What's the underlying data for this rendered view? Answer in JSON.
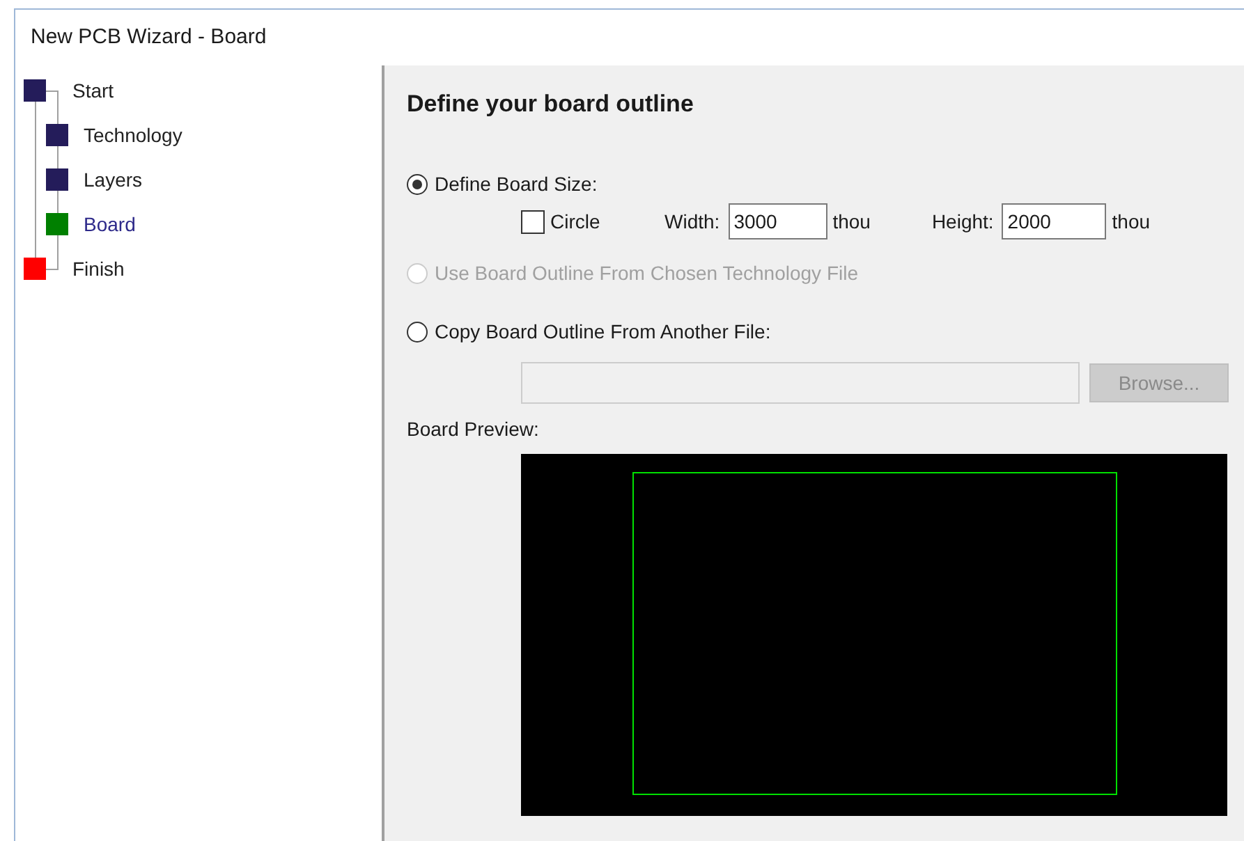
{
  "window": {
    "title": "New PCB Wizard - Board"
  },
  "steps": [
    {
      "label": "Start",
      "color": "#241c5a",
      "selected": false,
      "children": [
        {
          "label": "Technology",
          "color": "#241c5a",
          "selected": false
        },
        {
          "label": "Layers",
          "color": "#241c5a",
          "selected": false
        },
        {
          "label": "Board",
          "color": "#008000",
          "selected": true
        }
      ]
    },
    {
      "label": "Finish",
      "color": "#ff0000",
      "selected": false
    }
  ],
  "heading": "Define your board outline",
  "options": [
    {
      "kind": "size",
      "label": "Define Board Size:",
      "selected": true,
      "disabled": false,
      "circle": {
        "label": "Circle",
        "checked": false
      },
      "width": {
        "label": "Width:",
        "value": "3000",
        "unit": "thou"
      },
      "height": {
        "label": "Height:",
        "value": "2000",
        "unit": "thou"
      }
    },
    {
      "kind": "plain",
      "label": "Use Board Outline From Chosen Technology File",
      "selected": false,
      "disabled": true
    },
    {
      "kind": "file",
      "label": "Copy Board Outline From Another File:",
      "selected": false,
      "disabled": false,
      "browse": {
        "label": "Browse...",
        "disabled": true
      }
    }
  ],
  "preview": {
    "label": "Board Preview:"
  }
}
